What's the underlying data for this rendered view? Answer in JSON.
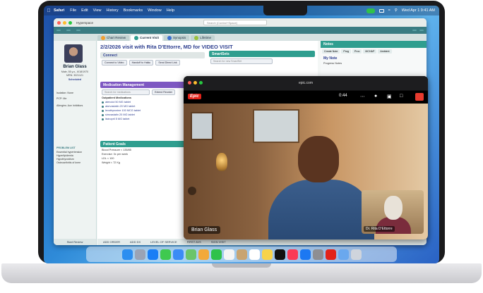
{
  "menubar": {
    "app_name": "Safari",
    "items": [
      "File",
      "Edit",
      "View",
      "History",
      "Bookmarks",
      "Window",
      "Help"
    ],
    "datetime": "Wed Apr 1  9:41 AM"
  },
  "epic": {
    "search_placeholder": "Search (Control+Space)",
    "toolbar_label": "Hyperspace",
    "tabs": [
      "Chart Review",
      "Current Visit",
      "Synopsis",
      "Lifetime"
    ],
    "visit_title": "2/2/2026 visit with Rita D'Ettorre, MD for VIDEO VISIT",
    "patient": {
      "name": "Brian Glass",
      "line1": "Male, 55 y.o., 6/18/1970",
      "line2": "MRN: 3021121",
      "status": "Scheduled",
      "pcp": "PCP: Me",
      "isolation": "Isolation: None",
      "allergies": "Allergies: Ace Inhibitors",
      "problem_head": "PROBLEM LIST",
      "problems": [
        "Essential hypertension",
        "Hyperlipidemia",
        "Hypothyroidism",
        "Osteoarthritis of knee"
      ],
      "footer": "Start Review"
    },
    "connect": {
      "title": "Connect",
      "buttons": [
        "Connect to Video",
        "Handoff to Haiku",
        "Send Direct Link"
      ]
    },
    "medication": {
      "title": "Medication Management",
      "search_placeholder": "Search for medications",
      "extend": "Extend Reorder",
      "section": "Outpatient Medications",
      "items": [
        "atenolol 50 MG tablet",
        "atorvastatin 20 MG tablet",
        "levothyroxine 100 MCG tablet",
        "simvastatin 20 MG tablet",
        "lisinopril 5 MG tablet"
      ]
    },
    "goals": {
      "title": "Patient Goals",
      "items": [
        {
          "label": "Blood Pressure < 135/85",
          "value": "133/86"
        },
        {
          "label": "Exercise: 3x per week",
          "value": "On track"
        },
        {
          "label": "LDL < 100",
          "value": "101"
        },
        {
          "label": "Weight < 72 Kg",
          "value": "79.4 kg"
        }
      ]
    },
    "smartsets": {
      "title": "SmartSets",
      "search_placeholder": "Search for new SmartSet"
    },
    "notes": {
      "title": "Notes",
      "tabs": [
        "Create Note",
        "Prog",
        "Proc",
        "MCHAP",
        "Ambient"
      ],
      "my_note": "My Note",
      "note_type": "Progress Notes"
    },
    "bottombar": [
      "ADD ORDER",
      "ADD DX",
      "LEVEL OF SERVICE",
      "FIRST AVS",
      "SIGN VISIT"
    ]
  },
  "facetime": {
    "url": "epic.com",
    "timer": "0:44",
    "main_caller": "Brian Glass",
    "pip_caller": "Dr. Rita D'Ettorre"
  },
  "colors": {
    "accent_teal": "#2f9e8f",
    "medication_purple": "#7e58c2",
    "epic_red": "#e2231a",
    "end_call_red": "#e63a2e"
  }
}
